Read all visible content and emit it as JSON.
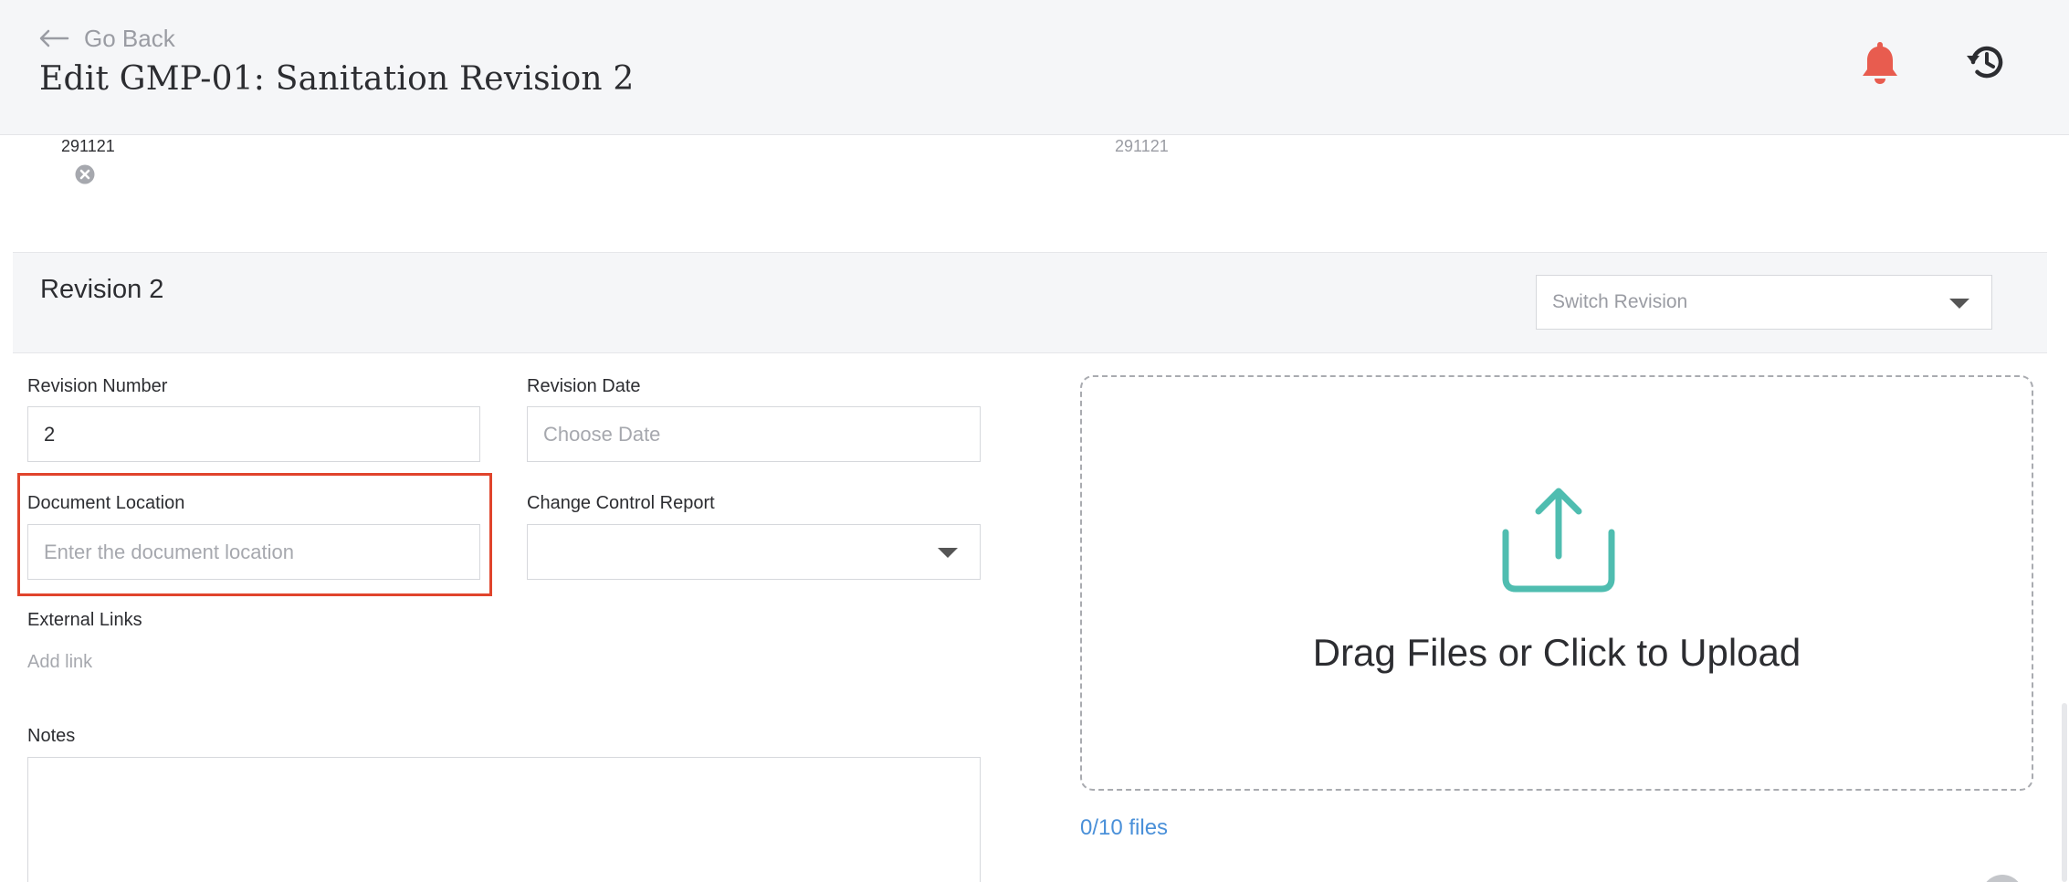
{
  "header": {
    "back_label": "Go Back",
    "title": "Edit GMP-01: Sanitation Revision 2",
    "notification_icon": "bell-icon",
    "history_icon": "history-icon",
    "accent_color": "#e85c4f"
  },
  "previous": {
    "left_value": "291121",
    "right_value": "291121",
    "remove_icon": "close-circle-icon"
  },
  "revision": {
    "title": "Revision 2",
    "switch_placeholder": "Switch Revision"
  },
  "form": {
    "revision_number": {
      "label": "Revision Number",
      "value": "2"
    },
    "revision_date": {
      "label": "Revision Date",
      "placeholder": "Choose Date"
    },
    "document_location": {
      "label": "Document Location",
      "placeholder": "Enter the document location"
    },
    "change_control": {
      "label": "Change Control Report",
      "value": ""
    },
    "external_links": {
      "label": "External Links",
      "add_label": "Add link"
    },
    "notes": {
      "label": "Notes",
      "value": ""
    }
  },
  "upload": {
    "text": "Drag Files or Click to Upload",
    "icon": "upload-icon",
    "icon_color": "#4fbdb0",
    "file_count": "0/10 files"
  },
  "colors": {
    "highlight": "#e0442c",
    "link": "#4a90d9"
  }
}
